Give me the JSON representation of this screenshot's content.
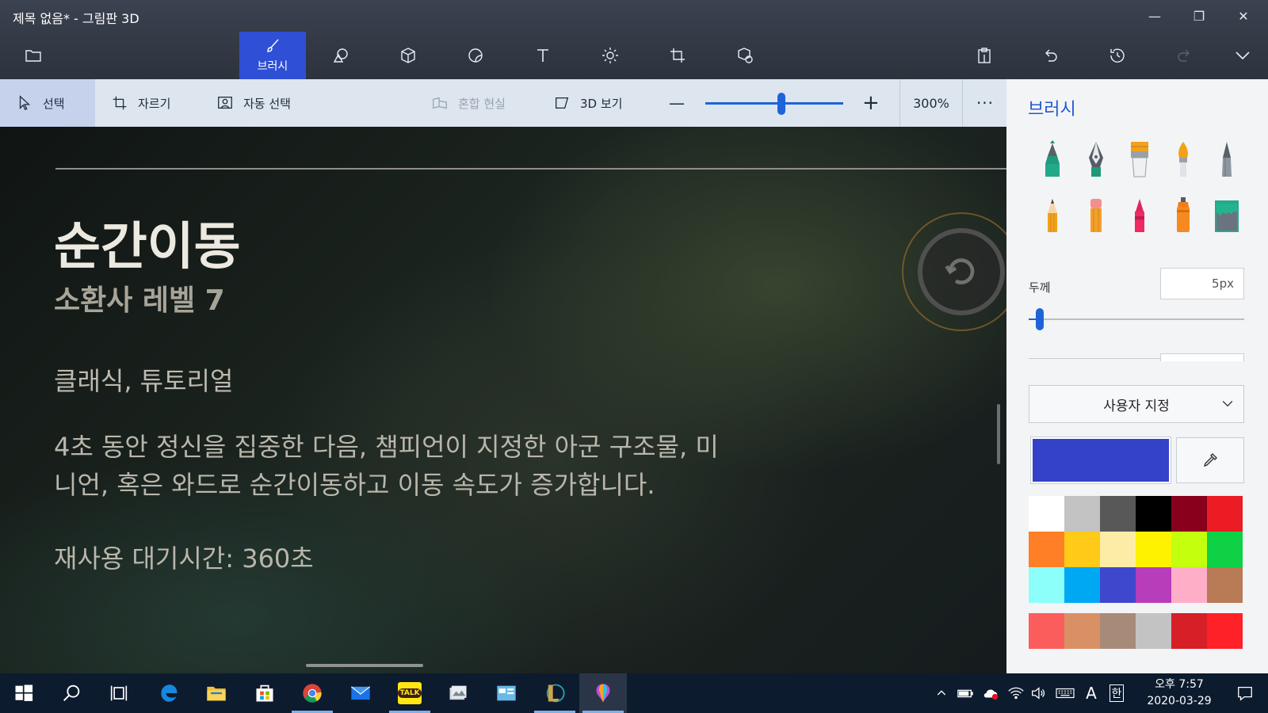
{
  "window": {
    "title": "제목 없음* - 그림판 3D",
    "minimize": "—",
    "restore": "❐",
    "close": "✕"
  },
  "toolbar": {
    "active_tool_label": "브러시",
    "tools": [
      "folder-icon",
      "brush-icon",
      "2d-shapes-icon",
      "3d-shapes-icon",
      "stickers-icon",
      "text-icon",
      "effects-icon",
      "canvas-icon",
      "3d-library-icon",
      "paste-icon",
      "undo-icon",
      "history-icon",
      "redo-icon",
      "chevron-down-icon"
    ]
  },
  "commandbar": {
    "select": "선택",
    "crop": "자르기",
    "magic_select": "자동 선택",
    "mixed_reality": "혼합 현실",
    "view_3d": "3D 보기",
    "zoom_out": "—",
    "zoom_in": "+",
    "zoom_value": "300%",
    "zoom_level_percent": 300,
    "more": "···"
  },
  "canvas": {
    "title": "순간이동",
    "subtitle": "소환사 레벨 7",
    "modes": "클래식, 튜토리얼",
    "description_line1": "4초 동안 정신을 집중한 다음, 챔피언이 지정한 아군 구조물, 미",
    "description_line2": "니언, 혹은 와드로 순간이동하고 이동 속도가 증가합니다.",
    "cooldown": "재사용 대기시간: 360초"
  },
  "panel": {
    "title": "브러시",
    "brushes": [
      "marker",
      "calligraphy-pen",
      "oil-brush",
      "watercolor",
      "pixel-pen",
      "pencil",
      "eraser",
      "crayon",
      "spray-can",
      "fill-bucket"
    ],
    "thickness_label": "두께",
    "thickness_value": "5px",
    "thickness_fraction": 0.05,
    "color_dropdown": "사용자 지정",
    "current_color": "#3441c9",
    "palette": [
      "#ffffff",
      "#c3c3c3",
      "#585858",
      "#000000",
      "#88001b",
      "#ec1c24",
      "#ff7f27",
      "#ffca18",
      "#fdeca6",
      "#fff200",
      "#c4ff0e",
      "#0ed145",
      "#8cfffb",
      "#00a8f3",
      "#3f48cc",
      "#b83dba",
      "#ffaec8",
      "#b97a56"
    ],
    "custom_colors": [
      "#fb5d5d",
      "#d99064",
      "#a88a78",
      "#c3c3c3",
      "#d61f26",
      "#ff2128"
    ]
  },
  "taskbar": {
    "apps": [
      "start-icon",
      "search-icon",
      "task-view-icon",
      "edge-icon",
      "file-explorer-icon",
      "store-icon",
      "chrome-icon",
      "mail-icon",
      "kakaotalk-icon",
      "photos-icon",
      "app-icon",
      "league-of-legends-icon",
      "paint-3d-icon"
    ],
    "kakaotalk_label": "TALK",
    "ime_lang": "A",
    "ime_mode": "한",
    "time": "오후 7:57",
    "date": "2020-03-29"
  }
}
